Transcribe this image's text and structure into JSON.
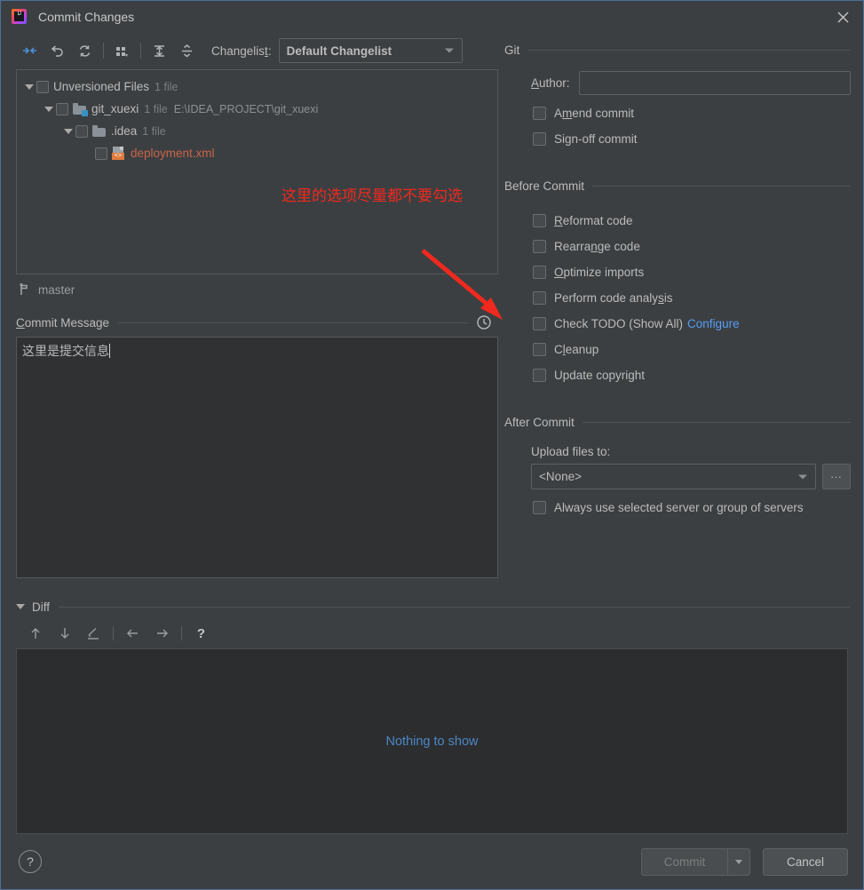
{
  "window": {
    "title": "Commit Changes",
    "logo_icon": "intellij-idea-logo",
    "close_icon": "close-icon"
  },
  "toolbar": {
    "buttons": [
      {
        "name": "show-diff",
        "icon": "arrows-collapse-horizontal-icon"
      },
      {
        "name": "revert",
        "icon": "undo-arrow-icon"
      },
      {
        "name": "refresh",
        "icon": "refresh-icon"
      },
      {
        "name": "group-by",
        "icon": "group-by-icon"
      },
      {
        "name": "expand-all",
        "icon": "expand-all-icon"
      },
      {
        "name": "collapse-all",
        "icon": "collapse-all-icon"
      }
    ],
    "changelist_label": "Changelist:",
    "changelist_label_mnemonic": "t",
    "changelist_value": "Default Changelist"
  },
  "file_tree": {
    "rows": [
      {
        "label": "Unversioned Files",
        "count": "1 file",
        "path": "",
        "indent": 0,
        "icon": "none",
        "unversioned": false
      },
      {
        "label": "git_xuexi",
        "count": "1 file",
        "path": "E:\\IDEA_PROJECT\\git_xuexi",
        "indent": 1,
        "icon": "folder-module-icon",
        "unversioned": false
      },
      {
        "label": ".idea",
        "count": "1 file",
        "path": "",
        "indent": 2,
        "icon": "folder-icon",
        "unversioned": false
      },
      {
        "label": "deployment.xml",
        "count": "",
        "path": "",
        "indent": 3,
        "icon": "xml-file-icon",
        "unversioned": true
      }
    ]
  },
  "branch": {
    "icon": "git-branch-icon",
    "name": "master"
  },
  "commit_message": {
    "title": "Commit Message",
    "title_mnemonic": "C",
    "history_icon": "clock-history-icon",
    "value": "这里是提交信息"
  },
  "git_section": {
    "title": "Git",
    "author_label": "Author:",
    "author_label_mnemonic": "A",
    "author_value": "",
    "checkboxes": [
      {
        "label": "Amend commit",
        "mnemonic": "m",
        "checked": false
      },
      {
        "label": "Sign-off commit",
        "mnemonic": "g",
        "checked": false
      }
    ]
  },
  "before_commit": {
    "title": "Before Commit",
    "checkboxes": [
      {
        "label": "Reformat code",
        "mnemonic": "R",
        "checked": false,
        "link": ""
      },
      {
        "label": "Rearrange code",
        "mnemonic": "n",
        "checked": false,
        "link": ""
      },
      {
        "label": "Optimize imports",
        "mnemonic": "O",
        "checked": false,
        "link": ""
      },
      {
        "label": "Perform code analysis",
        "mnemonic": "s",
        "checked": false,
        "link": ""
      },
      {
        "label": "Check TODO (Show All)",
        "mnemonic": "",
        "checked": false,
        "link": "Configure"
      },
      {
        "label": "Cleanup",
        "mnemonic": "l",
        "checked": false,
        "link": ""
      },
      {
        "label": "Update copyright",
        "mnemonic": "",
        "checked": false,
        "link": ""
      }
    ]
  },
  "after_commit": {
    "title": "After Commit",
    "upload_label": "Upload files to:",
    "upload_value": "<None>",
    "browse_label": "...",
    "always_use_label": "Always use selected server or group of servers",
    "always_use_checked": false
  },
  "diff": {
    "title": "Diff",
    "expanded": true,
    "toolbar": [
      {
        "name": "previous-difference",
        "icon": "arrow-up-icon"
      },
      {
        "name": "next-difference",
        "icon": "arrow-down-icon"
      },
      {
        "name": "edit-source",
        "icon": "pencil-icon"
      },
      {
        "name": "previous-file",
        "icon": "arrow-left-icon"
      },
      {
        "name": "next-file",
        "icon": "arrow-right-icon"
      },
      {
        "name": "diff-help",
        "icon": "question-mark-icon"
      }
    ],
    "empty_text": "Nothing to show"
  },
  "footer": {
    "help_label": "?",
    "commit_label": "Commit",
    "commit_enabled": false,
    "commit_dropdown_icon": "chevron-down-icon",
    "cancel_label": "Cancel"
  },
  "annotations": {
    "note_text": "这里的选项尽量都不要勾选",
    "note_color": "#f0291f",
    "arrow_color": "#f0291f"
  }
}
